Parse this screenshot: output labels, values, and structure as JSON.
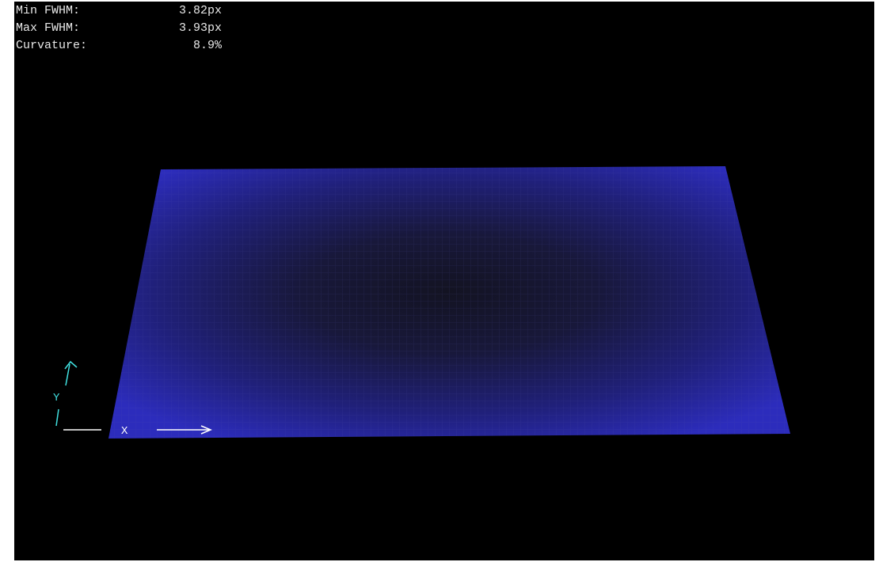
{
  "stats": [
    {
      "label": "Min FWHM:",
      "value": "3.82px"
    },
    {
      "label": "Max FWHM:",
      "value": "3.93px"
    },
    {
      "label": "Curvature:",
      "value": "8.9%"
    }
  ],
  "axes": {
    "x_label": "X",
    "y_label": "Y"
  },
  "colors": {
    "background": "#000000",
    "surface_edge": "#2a2ab8",
    "surface_center": "#141428",
    "axis_x": "#ffffff",
    "axis_y": "#40e0e0",
    "text": "#e8e8e8"
  }
}
